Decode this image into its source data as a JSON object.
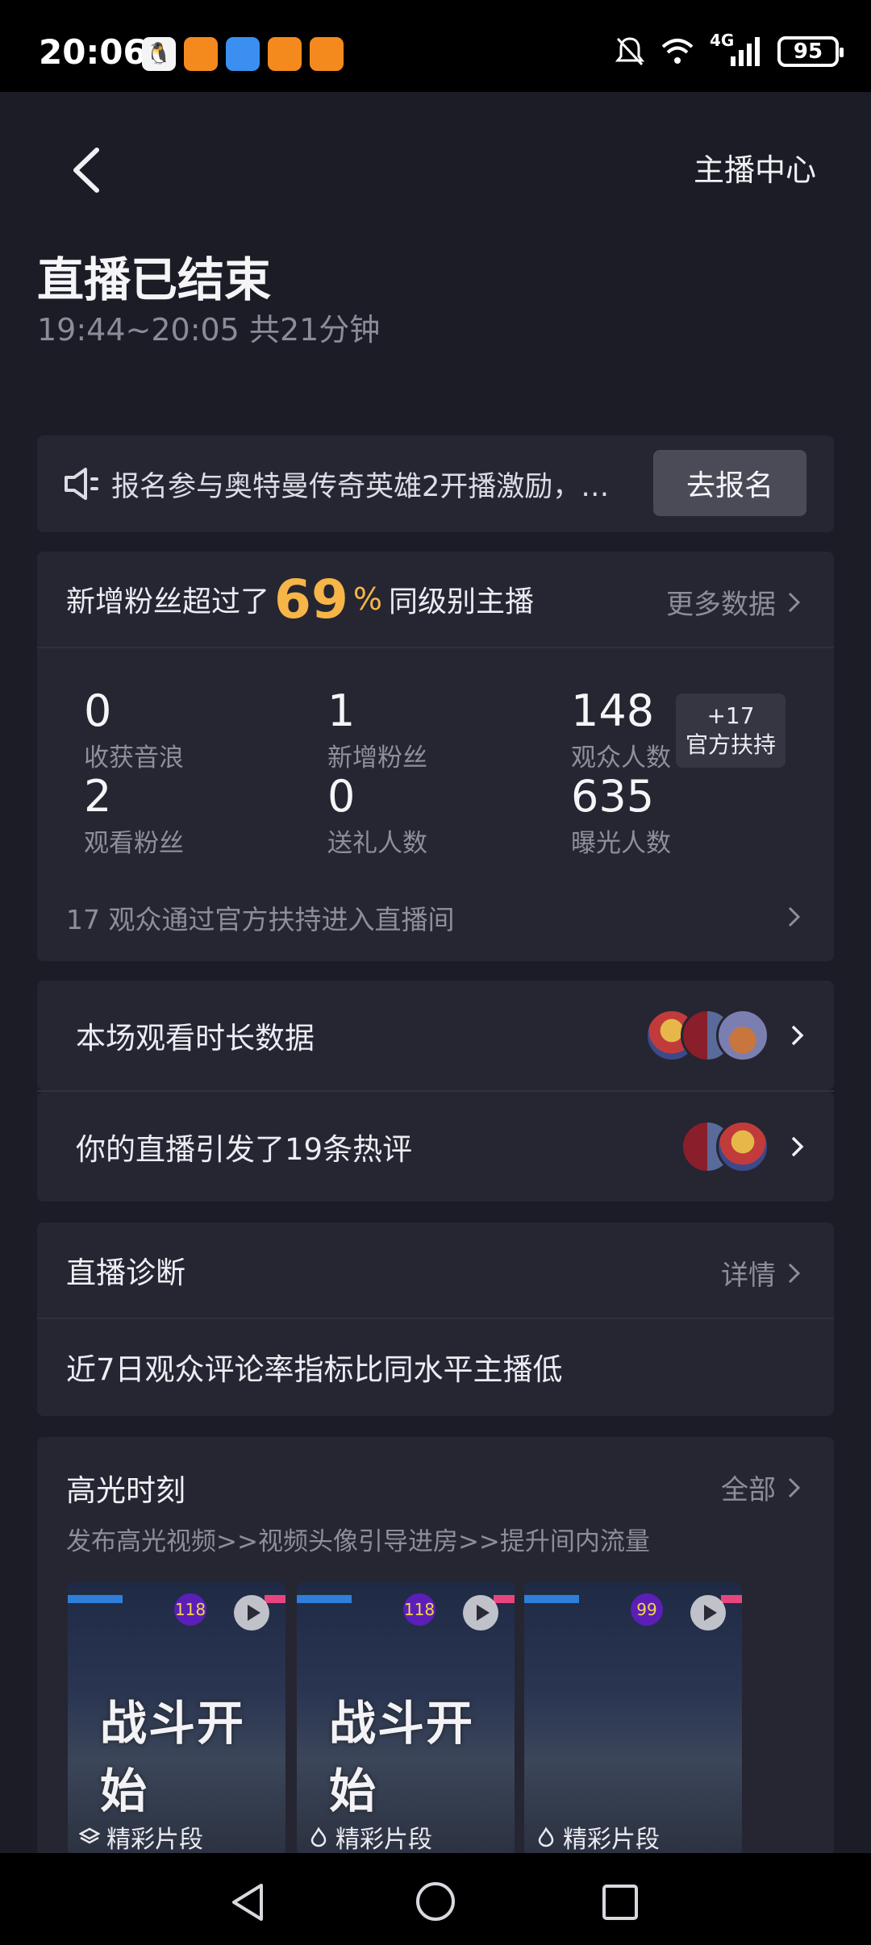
{
  "status": {
    "time": "20:06",
    "network": "4G",
    "battery": "95",
    "app_icons": [
      "qq-penguin-icon",
      "app-orange-icon",
      "weather-icon",
      "app-orange-icon",
      "app-orange-icon"
    ]
  },
  "header": {
    "anchor_center": "主播中心"
  },
  "summary": {
    "title": "直播已结束",
    "subtitle": "19:44~20:05 共21分钟"
  },
  "notice": {
    "text": "报名参与奥特曼传奇英雄2开播激励，…",
    "button": "去报名"
  },
  "fans_compare": {
    "prefix": "新增粉丝超过了",
    "percent": "69",
    "percent_sign": "%",
    "suffix": "同级别主播",
    "more": "更多数据"
  },
  "stats": [
    {
      "value": "0",
      "label": "收获音浪"
    },
    {
      "value": "1",
      "label": "新增粉丝"
    },
    {
      "value": "148",
      "label": "观众人数"
    },
    {
      "value": "2",
      "label": "观看粉丝"
    },
    {
      "value": "0",
      "label": "送礼人数"
    },
    {
      "value": "635",
      "label": "曝光人数"
    }
  ],
  "support_badge": {
    "value": "+17",
    "label": "官方扶持"
  },
  "stats_footer": "17 观众通过官方扶持进入直播间",
  "rows": {
    "watch_duration": "本场观看时长数据",
    "hot_comments": "你的直播引发了19条热评"
  },
  "diagnosis": {
    "title": "直播诊断",
    "detail": "详情",
    "body": "近7日观众评论率指标比同水平主播低"
  },
  "highlights": {
    "title": "高光时刻",
    "all": "全部",
    "subtitle": "发布高光视频>>视频头像引导进房>>提升间内流量",
    "clips": [
      {
        "level": "118",
        "overlay": "战斗开始",
        "caption": "精彩片段"
      },
      {
        "level": "118",
        "overlay": "战斗开始",
        "caption": "精彩片段"
      },
      {
        "level": "99",
        "overlay": "",
        "caption": "精彩片段"
      }
    ]
  },
  "colors": {
    "background": "#1b1c26",
    "card": "#252632",
    "accent_percent": "#f7b547"
  }
}
